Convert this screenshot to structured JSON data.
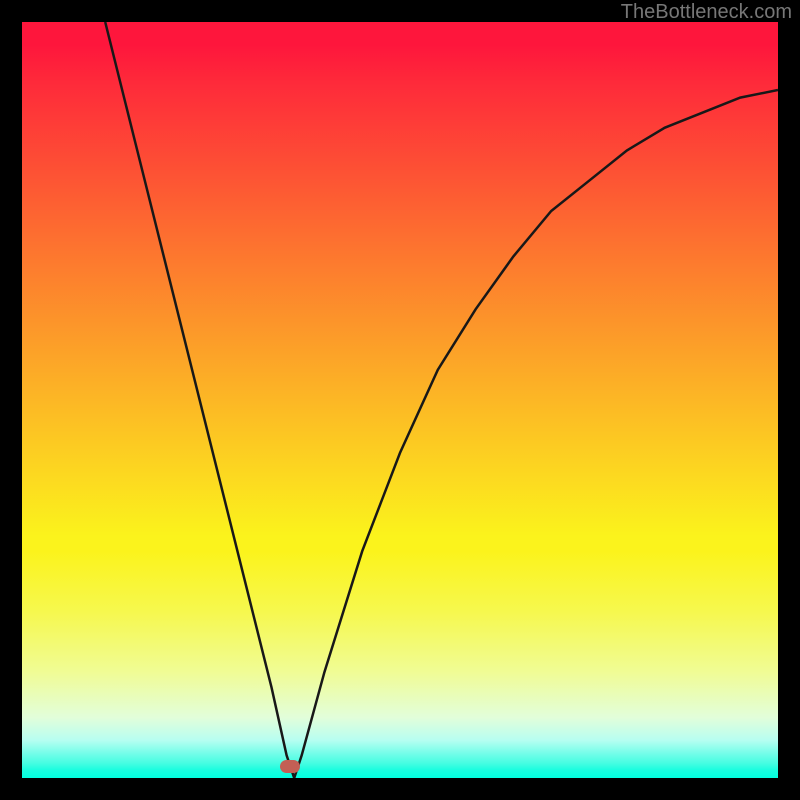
{
  "attribution": "TheBottleneck.com",
  "marker": {
    "x_pct": 35.5,
    "y_pct": 99.0
  },
  "chart_data": {
    "type": "line",
    "title": "",
    "xlabel": "",
    "ylabel": "",
    "xlim": [
      0,
      100
    ],
    "ylim": [
      0,
      100
    ],
    "gradient_direction": "vertical",
    "gradient_stops": [
      {
        "pos": 0,
        "color": "#fe163c"
      },
      {
        "pos": 50,
        "color": "#fcb825"
      },
      {
        "pos": 70,
        "color": "#fbf31c"
      },
      {
        "pos": 100,
        "color": "#02fedf"
      }
    ],
    "series": [
      {
        "name": "curve",
        "x": [
          11,
          15,
          20,
          25,
          30,
          33,
          35,
          36,
          37,
          40,
          45,
          50,
          55,
          60,
          65,
          70,
          75,
          80,
          85,
          90,
          95,
          100
        ],
        "y": [
          100,
          84,
          64,
          44,
          24,
          12,
          3,
          0,
          3,
          14,
          30,
          43,
          54,
          62,
          69,
          75,
          79,
          83,
          86,
          88,
          90,
          91
        ]
      }
    ],
    "marker_point": {
      "x": 35.5,
      "y": 0
    }
  }
}
